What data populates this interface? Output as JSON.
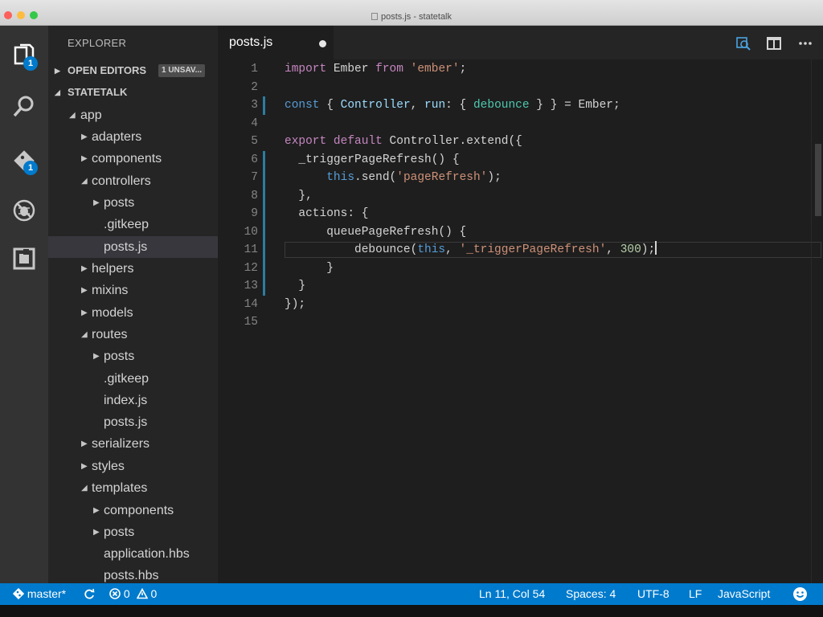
{
  "window": {
    "title": "posts.js - statetalk"
  },
  "activity_bar": {
    "items": [
      {
        "icon": "files-icon",
        "badge": "1"
      },
      {
        "icon": "search-icon"
      },
      {
        "icon": "source-control-icon",
        "badge": "1"
      },
      {
        "icon": "debug-icon"
      },
      {
        "icon": "extensions-icon"
      }
    ]
  },
  "sidebar": {
    "title": "EXPLORER",
    "open_editors": {
      "label": "OPEN EDITORS",
      "badge": "1 UNSAV..."
    },
    "project": {
      "label": "STATETALK"
    },
    "tree": [
      {
        "name": "app",
        "type": "folder",
        "open": true
      },
      {
        "name": "adapters",
        "type": "folder",
        "open": false
      },
      {
        "name": "components",
        "type": "folder",
        "open": false
      },
      {
        "name": "controllers",
        "type": "folder",
        "open": true
      },
      {
        "name": "posts",
        "type": "folder",
        "open": false
      },
      {
        "name": ".gitkeep",
        "type": "file"
      },
      {
        "name": "posts.js",
        "type": "file",
        "selected": true
      },
      {
        "name": "helpers",
        "type": "folder",
        "open": false
      },
      {
        "name": "mixins",
        "type": "folder",
        "open": false
      },
      {
        "name": "models",
        "type": "folder",
        "open": false
      },
      {
        "name": "routes",
        "type": "folder",
        "open": true
      },
      {
        "name": "posts",
        "type": "folder",
        "open": false
      },
      {
        "name": ".gitkeep",
        "type": "file"
      },
      {
        "name": "index.js",
        "type": "file"
      },
      {
        "name": "posts.js",
        "type": "file"
      },
      {
        "name": "serializers",
        "type": "folder",
        "open": false
      },
      {
        "name": "styles",
        "type": "folder",
        "open": false
      },
      {
        "name": "templates",
        "type": "folder",
        "open": true
      },
      {
        "name": "components",
        "type": "folder",
        "open": false
      },
      {
        "name": "posts",
        "type": "folder",
        "open": false
      },
      {
        "name": "application.hbs",
        "type": "file"
      },
      {
        "name": "posts.hbs",
        "type": "file"
      }
    ]
  },
  "editor": {
    "tab": {
      "label": "posts.js",
      "dirty": true
    },
    "lines": [
      {
        "num": "1",
        "tokens": [
          {
            "t": "import",
            "c": "kw"
          },
          {
            "t": " Ember ",
            "c": "pl"
          },
          {
            "t": "from",
            "c": "kw"
          },
          {
            "t": " ",
            "c": "pl"
          },
          {
            "t": "'ember'",
            "c": "st"
          },
          {
            "t": ";",
            "c": "pl"
          }
        ]
      },
      {
        "num": "2",
        "tokens": []
      },
      {
        "num": "3",
        "tokens": [
          {
            "t": "const",
            "c": "kb"
          },
          {
            "t": " { ",
            "c": "pl"
          },
          {
            "t": "Controller",
            "c": "vr"
          },
          {
            "t": ", ",
            "c": "pl"
          },
          {
            "t": "run",
            "c": "vr"
          },
          {
            "t": ": { ",
            "c": "pl"
          },
          {
            "t": "debounce",
            "c": "tp"
          },
          {
            "t": " } } = Ember;",
            "c": "pl"
          }
        ]
      },
      {
        "num": "4",
        "tokens": []
      },
      {
        "num": "5",
        "tokens": [
          {
            "t": "export",
            "c": "kw"
          },
          {
            "t": " ",
            "c": "pl"
          },
          {
            "t": "default",
            "c": "kw"
          },
          {
            "t": " Controller.extend({",
            "c": "pl"
          }
        ]
      },
      {
        "num": "6",
        "tokens": [
          {
            "t": "  _triggerPageRefresh() {",
            "c": "pl"
          }
        ]
      },
      {
        "num": "7",
        "tokens": [
          {
            "t": "      ",
            "c": "pl"
          },
          {
            "t": "this",
            "c": "kb"
          },
          {
            "t": ".send(",
            "c": "pl"
          },
          {
            "t": "'pageRefresh'",
            "c": "st"
          },
          {
            "t": ");",
            "c": "pl"
          }
        ]
      },
      {
        "num": "8",
        "tokens": [
          {
            "t": "  },",
            "c": "pl"
          }
        ]
      },
      {
        "num": "9",
        "tokens": [
          {
            "t": "  actions: {",
            "c": "pl"
          }
        ]
      },
      {
        "num": "10",
        "tokens": [
          {
            "t": "      queuePageRefresh() {",
            "c": "pl"
          }
        ]
      },
      {
        "num": "11",
        "tokens": [
          {
            "t": "          debounce(",
            "c": "pl"
          },
          {
            "t": "this",
            "c": "kb"
          },
          {
            "t": ", ",
            "c": "pl"
          },
          {
            "t": "'_triggerPageRefresh'",
            "c": "st"
          },
          {
            "t": ", ",
            "c": "pl"
          },
          {
            "t": "300",
            "c": "nu"
          },
          {
            "t": ");",
            "c": "pl"
          }
        ]
      },
      {
        "num": "12",
        "tokens": [
          {
            "t": "      }",
            "c": "pl"
          }
        ]
      },
      {
        "num": "13",
        "tokens": [
          {
            "t": "  }",
            "c": "pl"
          }
        ]
      },
      {
        "num": "14",
        "tokens": [
          {
            "t": "});",
            "c": "pl"
          }
        ]
      },
      {
        "num": "15",
        "tokens": []
      }
    ],
    "modified_lines": [
      "3",
      "6",
      "7",
      "8",
      "9",
      "10",
      "11",
      "12",
      "13"
    ],
    "cursor_line": "11"
  },
  "status_bar": {
    "branch": "master*",
    "errors": "0",
    "warnings": "0",
    "position": "Ln 11, Col 54",
    "indent": "Spaces: 4",
    "encoding": "UTF-8",
    "eol": "LF",
    "language": "JavaScript"
  },
  "colors": {
    "accent": "#007acc",
    "sidebar": "#252526",
    "editor_bg": "#1e1e1e",
    "activity_bar": "#333333"
  }
}
